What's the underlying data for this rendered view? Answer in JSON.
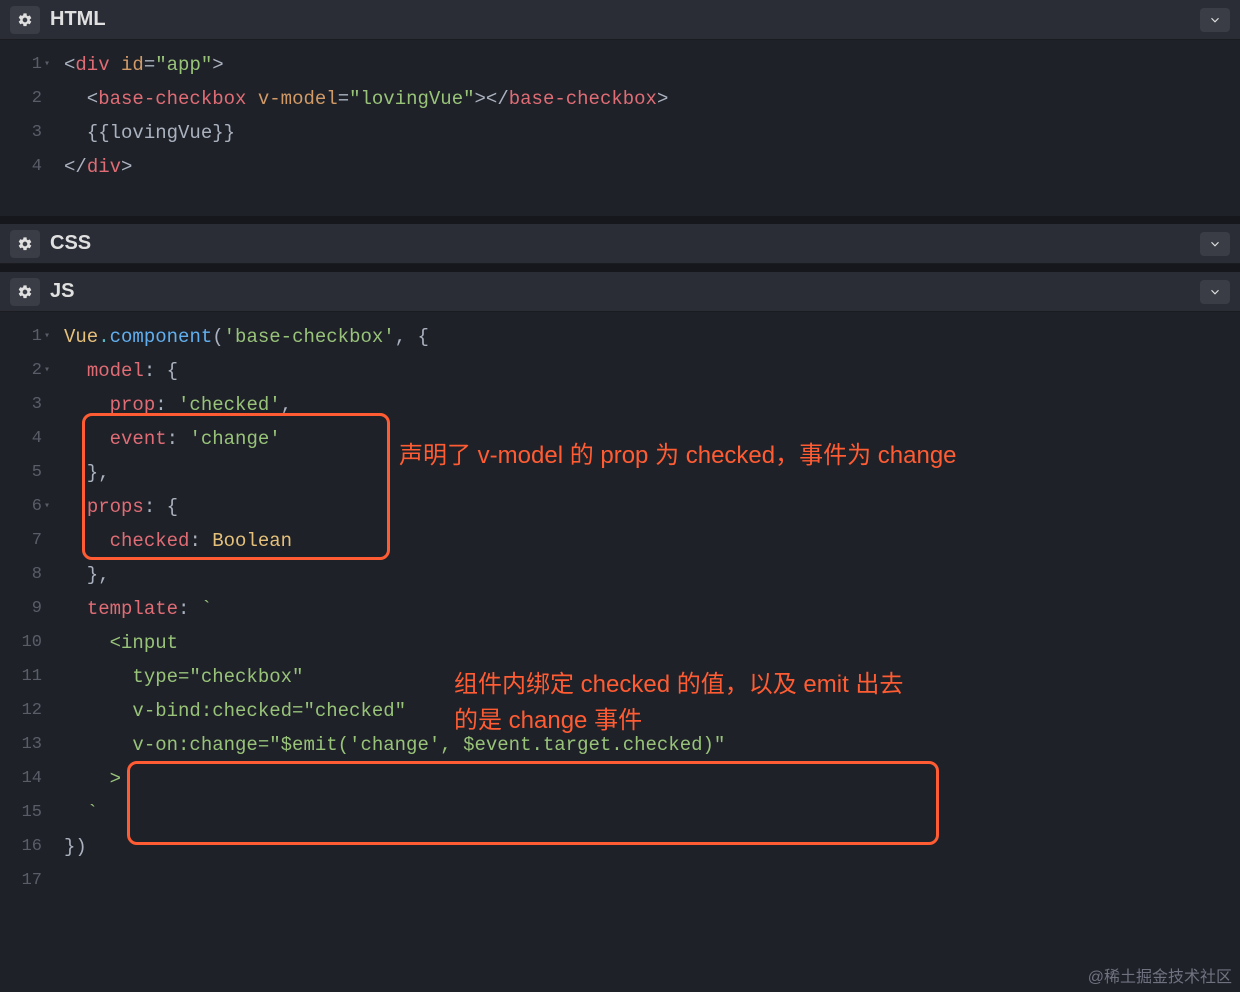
{
  "panels": {
    "html": "HTML",
    "css": "CSS",
    "js": "JS"
  },
  "html_lines": [
    {
      "n": "1",
      "arrow": true,
      "tokens": [
        [
          "t-punc",
          "<"
        ],
        [
          "t-tag",
          "div"
        ],
        [
          "t-txt",
          " "
        ],
        [
          "t-attr",
          "id"
        ],
        [
          "t-punc",
          "="
        ],
        [
          "t-str",
          "\"app\""
        ],
        [
          "t-punc",
          ">"
        ]
      ]
    },
    {
      "n": "2",
      "tokens": [
        [
          "t-punc",
          "  <"
        ],
        [
          "t-tag",
          "base-checkbox"
        ],
        [
          "t-txt",
          " "
        ],
        [
          "t-attr",
          "v-model"
        ],
        [
          "t-punc",
          "="
        ],
        [
          "t-str",
          "\"lovingVue\""
        ],
        [
          "t-punc",
          "></"
        ],
        [
          "t-tag",
          "base-checkbox"
        ],
        [
          "t-punc",
          ">"
        ]
      ]
    },
    {
      "n": "3",
      "tokens": [
        [
          "t-txt",
          "  {{lovingVue}}"
        ]
      ]
    },
    {
      "n": "4",
      "tokens": [
        [
          "t-punc",
          "</"
        ],
        [
          "t-tag",
          "div"
        ],
        [
          "t-punc",
          ">"
        ]
      ]
    }
  ],
  "js_lines": [
    {
      "n": "1",
      "arrow": true,
      "tokens": [
        [
          "t-obj",
          "Vue"
        ],
        [
          "t-dot",
          "."
        ],
        [
          "t-func",
          "component"
        ],
        [
          "t-punc",
          "("
        ],
        [
          "t-str",
          "'base-checkbox'"
        ],
        [
          "t-punc",
          ", {"
        ]
      ]
    },
    {
      "n": "2",
      "arrow": true,
      "tokens": [
        [
          "t-punc",
          "  "
        ],
        [
          "t-id",
          "model"
        ],
        [
          "t-punc",
          ": {"
        ]
      ]
    },
    {
      "n": "3",
      "tokens": [
        [
          "t-punc",
          "    "
        ],
        [
          "t-id",
          "prop"
        ],
        [
          "t-punc",
          ": "
        ],
        [
          "t-str",
          "'checked'"
        ],
        [
          "t-punc",
          ","
        ]
      ]
    },
    {
      "n": "4",
      "tokens": [
        [
          "t-punc",
          "    "
        ],
        [
          "t-id",
          "event"
        ],
        [
          "t-punc",
          ": "
        ],
        [
          "t-str",
          "'change'"
        ]
      ]
    },
    {
      "n": "5",
      "tokens": [
        [
          "t-punc",
          "  },"
        ]
      ]
    },
    {
      "n": "6",
      "arrow": true,
      "tokens": [
        [
          "t-punc",
          "  "
        ],
        [
          "t-id",
          "props"
        ],
        [
          "t-punc",
          ": {"
        ]
      ]
    },
    {
      "n": "7",
      "tokens": [
        [
          "t-punc",
          "    "
        ],
        [
          "t-id",
          "checked"
        ],
        [
          "t-punc",
          ": "
        ],
        [
          "t-type",
          "Boolean"
        ]
      ]
    },
    {
      "n": "8",
      "tokens": [
        [
          "t-punc",
          "  },"
        ]
      ]
    },
    {
      "n": "9",
      "tokens": [
        [
          "t-punc",
          "  "
        ],
        [
          "t-id",
          "template"
        ],
        [
          "t-punc",
          ": "
        ],
        [
          "t-str",
          "`"
        ]
      ]
    },
    {
      "n": "10",
      "tokens": [
        [
          "t-str",
          "    <input"
        ]
      ]
    },
    {
      "n": "11",
      "tokens": [
        [
          "t-str",
          "      type=\"checkbox\""
        ]
      ]
    },
    {
      "n": "12",
      "tokens": [
        [
          "t-str",
          "      v-bind:checked=\"checked\""
        ]
      ]
    },
    {
      "n": "13",
      "tokens": [
        [
          "t-str",
          "      v-on:change=\"$emit('change', $event.target.checked)\""
        ]
      ]
    },
    {
      "n": "14",
      "tokens": [
        [
          "t-str",
          "    >"
        ]
      ]
    },
    {
      "n": "15",
      "tokens": [
        [
          "t-str",
          "  `"
        ]
      ]
    },
    {
      "n": "16",
      "tokens": [
        [
          "t-punc",
          "})"
        ]
      ]
    },
    {
      "n": "17",
      "tokens": []
    }
  ],
  "anno": {
    "a1": "声明了 v-model 的 prop 为 checked，事件为 change",
    "a2_l1": "组件内绑定 checked 的值，以及 emit 出去",
    "a2_l2": "的是 change 事件"
  },
  "watermark": "@稀土掘金技术社区"
}
